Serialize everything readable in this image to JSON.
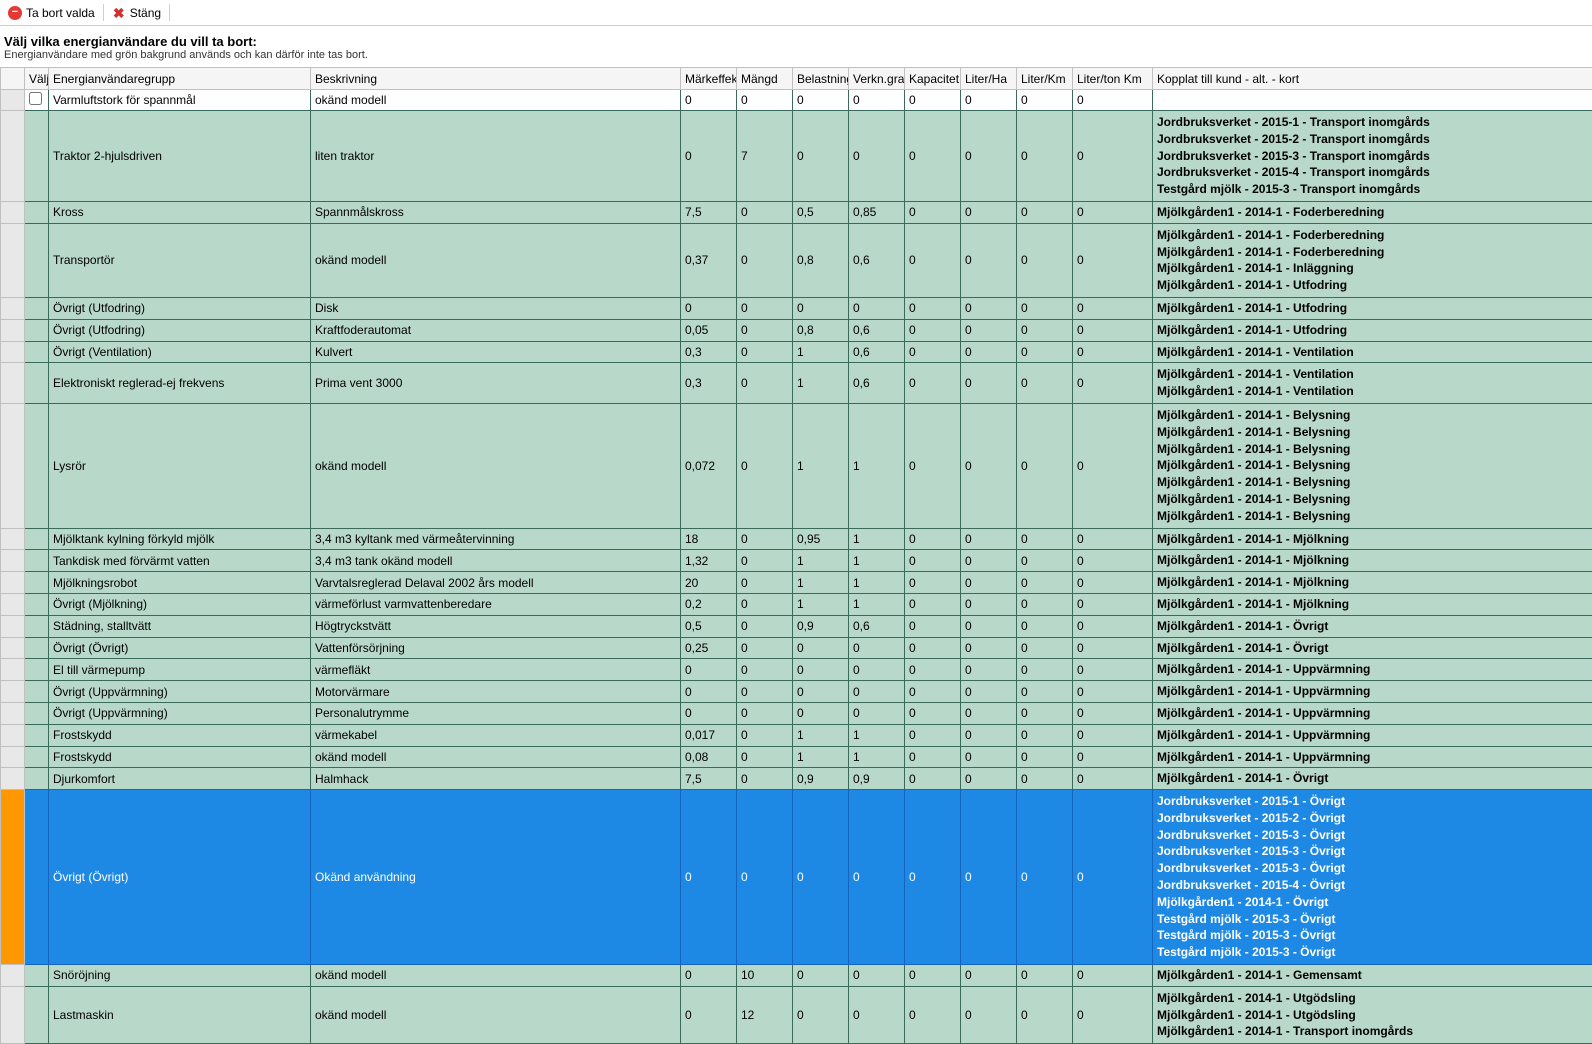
{
  "toolbar": {
    "remove_label": "Ta bort valda",
    "close_label": "Stäng"
  },
  "header": {
    "title": "Välj vilka energianvändare du vill ta bort:",
    "subtitle": "Energianvändare med grön bakgrund används och kan därför inte tas bort."
  },
  "columns": {
    "valj": "Välj",
    "grupp": "Energianvändaregrupp",
    "beskr": "Beskrivning",
    "markeffekt": "Märkeffekt",
    "mangd": "Mängd",
    "belastning": "Belastning",
    "verkngrad": "Verkn.grad",
    "kapacitet": "Kapacitet",
    "literha": "Liter/Ha",
    "literkm": "Liter/Km",
    "litertonkm": "Liter/ton Km",
    "kopplat": "Kopplat till kund - alt. - kort"
  },
  "rows": [
    {
      "cls": "white",
      "checkbox": true,
      "grupp": "Varmluftstork för spannmål",
      "beskr": "okänd modell",
      "v": [
        "0",
        "0",
        "0",
        "0",
        "0",
        "0",
        "0",
        "0"
      ],
      "kopplat": []
    },
    {
      "cls": "green",
      "grupp": "Traktor 2-hjulsdriven",
      "beskr": "liten traktor",
      "v": [
        "0",
        "7",
        "0",
        "0",
        "0",
        "0",
        "0",
        "0"
      ],
      "kopplat": [
        "Jordbruksverket - 2015-1 - Transport inomgårds",
        "Jordbruksverket - 2015-2 - Transport inomgårds",
        "Jordbruksverket - 2015-3 - Transport inomgårds",
        "Jordbruksverket - 2015-4 - Transport inomgårds",
        "Testgård mjölk - 2015-3 - Transport inomgårds"
      ]
    },
    {
      "cls": "green",
      "grupp": "Kross",
      "beskr": "Spannmålskross",
      "v": [
        "7,5",
        "0",
        "0,5",
        "0,85",
        "0",
        "0",
        "0",
        "0"
      ],
      "kopplat": [
        "Mjölkgården1 - 2014-1 - Foderberedning"
      ]
    },
    {
      "cls": "green",
      "grupp": "Transportör",
      "beskr": "okänd modell",
      "v": [
        "0,37",
        "0",
        "0,8",
        "0,6",
        "0",
        "0",
        "0",
        "0"
      ],
      "kopplat": [
        "Mjölkgården1 - 2014-1 - Foderberedning",
        "Mjölkgården1 - 2014-1 - Foderberedning",
        "Mjölkgården1 - 2014-1 - Inläggning",
        "Mjölkgården1 - 2014-1 - Utfodring"
      ]
    },
    {
      "cls": "green",
      "grupp": "Övrigt (Utfodring)",
      "beskr": "Disk",
      "v": [
        "0",
        "0",
        "0",
        "0",
        "0",
        "0",
        "0",
        "0"
      ],
      "kopplat": [
        "Mjölkgården1 - 2014-1 - Utfodring"
      ]
    },
    {
      "cls": "green",
      "grupp": "Övrigt (Utfodring)",
      "beskr": "Kraftfoderautomat",
      "v": [
        "0,05",
        "0",
        "0,8",
        "0,6",
        "0",
        "0",
        "0",
        "0"
      ],
      "kopplat": [
        "Mjölkgården1 - 2014-1 - Utfodring"
      ]
    },
    {
      "cls": "green",
      "grupp": "Övrigt (Ventilation)",
      "beskr": "Kulvert",
      "v": [
        "0,3",
        "0",
        "1",
        "0,6",
        "0",
        "0",
        "0",
        "0"
      ],
      "kopplat": [
        "Mjölkgården1 - 2014-1 - Ventilation"
      ]
    },
    {
      "cls": "green",
      "grupp": "Elektroniskt reglerad-ej frekvens",
      "beskr": "Prima vent 3000",
      "v": [
        "0,3",
        "0",
        "1",
        "0,6",
        "0",
        "0",
        "0",
        "0"
      ],
      "kopplat": [
        "Mjölkgården1 - 2014-1 - Ventilation",
        "Mjölkgården1 - 2014-1 - Ventilation"
      ]
    },
    {
      "cls": "green",
      "grupp": "Lysrör",
      "beskr": "okänd modell",
      "v": [
        "0,072",
        "0",
        "1",
        "1",
        "0",
        "0",
        "0",
        "0"
      ],
      "kopplat": [
        "Mjölkgården1 - 2014-1 - Belysning",
        "Mjölkgården1 - 2014-1 - Belysning",
        "Mjölkgården1 - 2014-1 - Belysning",
        "Mjölkgården1 - 2014-1 - Belysning",
        "Mjölkgården1 - 2014-1 - Belysning",
        "Mjölkgården1 - 2014-1 - Belysning",
        "Mjölkgården1 - 2014-1 - Belysning"
      ]
    },
    {
      "cls": "green",
      "grupp": "Mjölktank kylning förkyld mjölk",
      "beskr": "3,4 m3 kyltank med värmeåtervinning",
      "v": [
        "18",
        "0",
        "0,95",
        "1",
        "0",
        "0",
        "0",
        "0"
      ],
      "kopplat": [
        "Mjölkgården1 - 2014-1 - Mjölkning"
      ]
    },
    {
      "cls": "green",
      "grupp": "Tankdisk med förvärmt vatten",
      "beskr": "3,4 m3 tank okänd modell",
      "v": [
        "1,32",
        "0",
        "1",
        "1",
        "0",
        "0",
        "0",
        "0"
      ],
      "kopplat": [
        "Mjölkgården1 - 2014-1 - Mjölkning"
      ]
    },
    {
      "cls": "green",
      "grupp": "Mjölkningsrobot",
      "beskr": "Varvtalsreglerad Delaval 2002 års modell",
      "v": [
        "20",
        "0",
        "1",
        "1",
        "0",
        "0",
        "0",
        "0"
      ],
      "kopplat": [
        "Mjölkgården1 - 2014-1 - Mjölkning"
      ]
    },
    {
      "cls": "green",
      "grupp": "Övrigt (Mjölkning)",
      "beskr": "värmeförlust varmvattenberedare",
      "v": [
        "0,2",
        "0",
        "1",
        "1",
        "0",
        "0",
        "0",
        "0"
      ],
      "kopplat": [
        "Mjölkgården1 - 2014-1 - Mjölkning"
      ]
    },
    {
      "cls": "green",
      "grupp": "Städning, stalltvätt",
      "beskr": "Högtryckstvätt",
      "v": [
        "0,5",
        "0",
        "0,9",
        "0,6",
        "0",
        "0",
        "0",
        "0"
      ],
      "kopplat": [
        "Mjölkgården1 - 2014-1 - Övrigt"
      ]
    },
    {
      "cls": "green",
      "grupp": "Övrigt (Övrigt)",
      "beskr": "Vattenförsörjning",
      "v": [
        "0,25",
        "0",
        "0",
        "0",
        "0",
        "0",
        "0",
        "0"
      ],
      "kopplat": [
        "Mjölkgården1 - 2014-1 - Övrigt"
      ]
    },
    {
      "cls": "green",
      "grupp": "El till värmepump",
      "beskr": "värmefläkt",
      "v": [
        "0",
        "0",
        "0",
        "0",
        "0",
        "0",
        "0",
        "0"
      ],
      "kopplat": [
        "Mjölkgården1 - 2014-1 - Uppvärmning"
      ]
    },
    {
      "cls": "green",
      "grupp": "Övrigt (Uppvärmning)",
      "beskr": "Motorvärmare",
      "v": [
        "0",
        "0",
        "0",
        "0",
        "0",
        "0",
        "0",
        "0"
      ],
      "kopplat": [
        "Mjölkgården1 - 2014-1 - Uppvärmning"
      ]
    },
    {
      "cls": "green",
      "grupp": "Övrigt (Uppvärmning)",
      "beskr": "Personalutrymme",
      "v": [
        "0",
        "0",
        "0",
        "0",
        "0",
        "0",
        "0",
        "0"
      ],
      "kopplat": [
        "Mjölkgården1 - 2014-1 - Uppvärmning"
      ]
    },
    {
      "cls": "green",
      "grupp": "Frostskydd",
      "beskr": "värmekabel",
      "v": [
        "0,017",
        "0",
        "1",
        "1",
        "0",
        "0",
        "0",
        "0"
      ],
      "kopplat": [
        "Mjölkgården1 - 2014-1 - Uppvärmning"
      ]
    },
    {
      "cls": "green",
      "grupp": "Frostskydd",
      "beskr": "okänd modell",
      "v": [
        "0,08",
        "0",
        "1",
        "1",
        "0",
        "0",
        "0",
        "0"
      ],
      "kopplat": [
        "Mjölkgården1 - 2014-1 - Uppvärmning"
      ]
    },
    {
      "cls": "green",
      "grupp": "Djurkomfort",
      "beskr": "Halmhack",
      "v": [
        "7,5",
        "0",
        "0,9",
        "0,9",
        "0",
        "0",
        "0",
        "0"
      ],
      "kopplat": [
        "Mjölkgården1 - 2014-1 - Övrigt"
      ]
    },
    {
      "cls": "selected",
      "grupp": "Övrigt (Övrigt)",
      "beskr": "Okänd användning",
      "v": [
        "0",
        "0",
        "0",
        "0",
        "0",
        "0",
        "0",
        "0"
      ],
      "kopplat": [
        "Jordbruksverket - 2015-1 - Övrigt",
        "Jordbruksverket - 2015-2 - Övrigt",
        "Jordbruksverket - 2015-3 - Övrigt",
        "Jordbruksverket - 2015-3 - Övrigt",
        "Jordbruksverket - 2015-3 - Övrigt",
        "Jordbruksverket - 2015-4 - Övrigt",
        "Mjölkgården1 - 2014-1 - Övrigt",
        "Testgård mjölk - 2015-3 - Övrigt",
        "Testgård mjölk - 2015-3 - Övrigt",
        "Testgård mjölk - 2015-3 - Övrigt"
      ]
    },
    {
      "cls": "green",
      "grupp": "Snöröjning",
      "beskr": "okänd modell",
      "v": [
        "0",
        "10",
        "0",
        "0",
        "0",
        "0",
        "0",
        "0"
      ],
      "kopplat": [
        "Mjölkgården1 - 2014-1 - Gemensamt"
      ]
    },
    {
      "cls": "green",
      "grupp": "Lastmaskin",
      "beskr": "okänd modell",
      "v": [
        "0",
        "12",
        "0",
        "0",
        "0",
        "0",
        "0",
        "0"
      ],
      "kopplat": [
        "Mjölkgården1 - 2014-1 - Utgödsling",
        "Mjölkgården1 - 2014-1 - Utgödsling",
        "Mjölkgården1 - 2014-1 - Transport inomgårds"
      ]
    }
  ]
}
